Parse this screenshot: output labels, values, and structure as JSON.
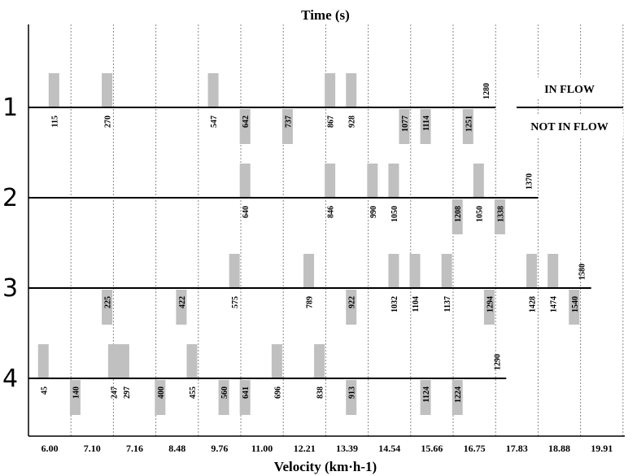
{
  "chart_data": {
    "type": "bar",
    "title": "Time (s)",
    "xlabel": "Velocity (km·h-1)",
    "ylabel": "",
    "categories": [
      "6.00",
      "7.10",
      "7.16",
      "8.48",
      "9.76",
      "11.00",
      "12.21",
      "13.39",
      "14.54",
      "15.66",
      "16.75",
      "17.83",
      "18.88",
      "19.91"
    ],
    "rows": [
      "1",
      "2",
      "3",
      "4"
    ],
    "grid": "vertical dashed",
    "legend": {
      "position": "top-right",
      "above_label": "IN FLOW",
      "below_label": "NOT IN FLOW"
    },
    "colors": {
      "bar": "#c0c0c0",
      "axis": "#000000",
      "grid": "#888888"
    },
    "series": [
      {
        "name": "1",
        "end_time": "1280",
        "end_stage": 11.0,
        "events": [
          {
            "stage": 0.6,
            "label": "115",
            "state": "in_flow"
          },
          {
            "stage": 1.85,
            "label": "270",
            "state": "in_flow"
          },
          {
            "stage": 4.35,
            "label": "547",
            "state": "in_flow"
          },
          {
            "stage": 5.1,
            "label": "642",
            "state": "not_in_flow"
          },
          {
            "stage": 6.1,
            "label": "737",
            "state": "not_in_flow"
          },
          {
            "stage": 7.1,
            "label": "867",
            "state": "in_flow"
          },
          {
            "stage": 7.6,
            "label": "928",
            "state": "in_flow"
          },
          {
            "stage": 8.85,
            "label": "1077",
            "state": "not_in_flow"
          },
          {
            "stage": 9.35,
            "label": "1114",
            "state": "not_in_flow"
          },
          {
            "stage": 10.35,
            "label": "1251",
            "state": "not_in_flow"
          }
        ]
      },
      {
        "name": "2",
        "end_time": "1370",
        "end_stage": 12.0,
        "events": [
          {
            "stage": 5.1,
            "label": "640",
            "state": "in_flow"
          },
          {
            "stage": 7.1,
            "label": "846",
            "state": "in_flow"
          },
          {
            "stage": 8.1,
            "label": "990",
            "state": "in_flow"
          },
          {
            "stage": 8.6,
            "label": "1050",
            "state": "in_flow"
          },
          {
            "stage": 10.1,
            "label": "1208",
            "state": "not_in_flow"
          },
          {
            "stage": 10.6,
            "label": "1050",
            "state": "in_flow"
          },
          {
            "stage": 11.1,
            "label": "1338",
            "state": "not_in_flow"
          }
        ]
      },
      {
        "name": "3",
        "end_time": "1580",
        "end_stage": 13.25,
        "events": [
          {
            "stage": 1.85,
            "label": "225",
            "state": "not_in_flow"
          },
          {
            "stage": 3.6,
            "label": "422",
            "state": "not_in_flow"
          },
          {
            "stage": 4.85,
            "label": "575",
            "state": "in_flow"
          },
          {
            "stage": 6.6,
            "label": "789",
            "state": "in_flow"
          },
          {
            "stage": 7.6,
            "label": "922",
            "state": "not_in_flow"
          },
          {
            "stage": 8.6,
            "label": "1032",
            "state": "in_flow"
          },
          {
            "stage": 9.1,
            "label": "1104",
            "state": "in_flow"
          },
          {
            "stage": 9.85,
            "label": "1137",
            "state": "in_flow"
          },
          {
            "stage": 10.85,
            "label": "1294",
            "state": "not_in_flow"
          },
          {
            "stage": 11.85,
            "label": "1428",
            "state": "in_flow"
          },
          {
            "stage": 12.35,
            "label": "1474",
            "state": "in_flow"
          },
          {
            "stage": 12.85,
            "label": "1540",
            "state": "not_in_flow"
          }
        ]
      },
      {
        "name": "4",
        "end_time": "1290",
        "end_stage": 11.25,
        "events": [
          {
            "stage": 0.35,
            "label": "45",
            "state": "in_flow"
          },
          {
            "stage": 1.1,
            "label": "140",
            "state": "not_in_flow"
          },
          {
            "stage": 2.0,
            "label": "247",
            "state": "in_flow",
            "width": 2
          },
          {
            "stage": 2.3,
            "label": "297",
            "state": "in_flow",
            "label_only": true
          },
          {
            "stage": 3.1,
            "label": "400",
            "state": "not_in_flow"
          },
          {
            "stage": 3.85,
            "label": "455",
            "state": "in_flow"
          },
          {
            "stage": 4.6,
            "label": "560",
            "state": "not_in_flow"
          },
          {
            "stage": 5.1,
            "label": "641",
            "state": "not_in_flow"
          },
          {
            "stage": 5.85,
            "label": "696",
            "state": "in_flow"
          },
          {
            "stage": 6.85,
            "label": "838",
            "state": "in_flow"
          },
          {
            "stage": 7.6,
            "label": "913",
            "state": "not_in_flow"
          },
          {
            "stage": 9.35,
            "label": "1124",
            "state": "not_in_flow"
          },
          {
            "stage": 10.1,
            "label": "1224",
            "state": "not_in_flow"
          }
        ]
      }
    ]
  }
}
